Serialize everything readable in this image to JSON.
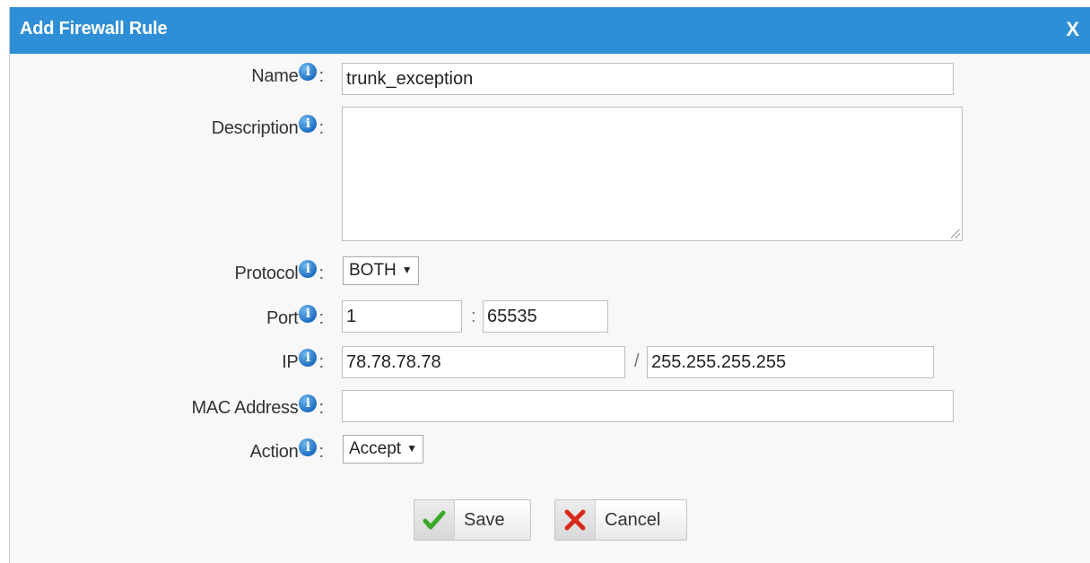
{
  "dialog": {
    "title": "Add Firewall Rule",
    "close_label": "X"
  },
  "fields": {
    "name": {
      "label": "Name",
      "value": "trunk_exception"
    },
    "description": {
      "label": "Description",
      "value": ""
    },
    "protocol": {
      "label": "Protocol",
      "value": "BOTH"
    },
    "port": {
      "label": "Port",
      "from": "1",
      "separator": ":",
      "to": "65535"
    },
    "ip": {
      "label": "IP",
      "address": "78.78.78.78",
      "separator": "/",
      "mask": "255.255.255.255"
    },
    "mac": {
      "label": "MAC Address",
      "value": ""
    },
    "action": {
      "label": "Action",
      "value": "Accept"
    }
  },
  "info_icon_glyph": "i",
  "label_colon": ":",
  "buttons": {
    "save_label": "Save",
    "cancel_label": "Cancel"
  },
  "colors": {
    "titlebar": "#2f8fd6",
    "save_check": "#3aa829",
    "cancel_x": "#d9291c"
  }
}
